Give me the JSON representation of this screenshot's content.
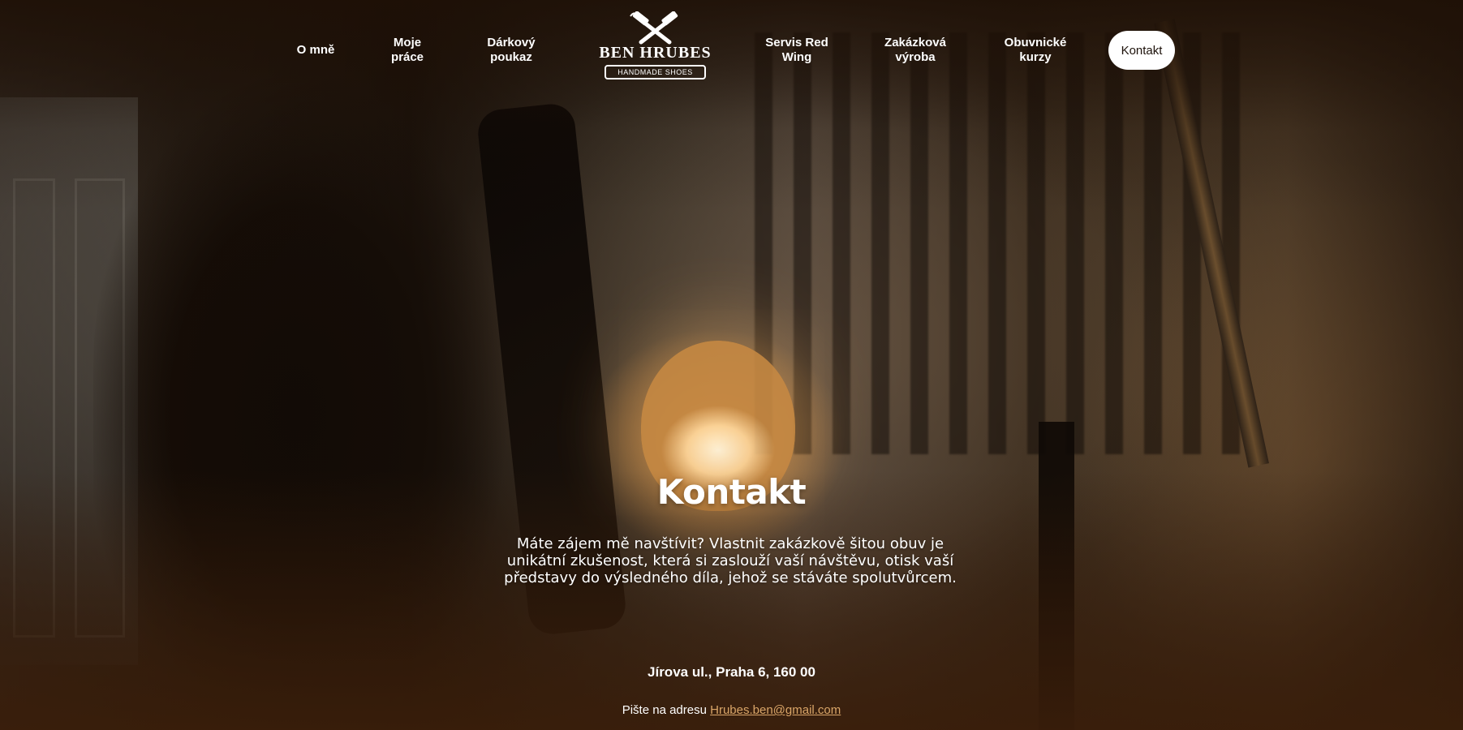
{
  "nav": {
    "items": [
      {
        "line1": "O mně",
        "line2": ""
      },
      {
        "line1": "Moje",
        "line2": "práce"
      },
      {
        "line1": "Dárkový",
        "line2": "poukaz"
      },
      {
        "line1": "Servis Red",
        "line2": "Wing"
      },
      {
        "line1": "Zakázková",
        "line2": "výroba"
      },
      {
        "line1": "Obuvnické",
        "line2": "kurzy"
      }
    ],
    "contact_label": "Kontakt"
  },
  "logo": {
    "name": "BEN HRUBES",
    "tagline": "HANDMADE SHOES",
    "icon": "crossed-hammers-icon"
  },
  "hero": {
    "title": "Kontakt",
    "intro_line1": "Máte zájem mě navštívit? Vlastnit zakázkově šitou obuv je",
    "intro_line2": "unikátní  zkušenost, která si zaslouží vaší návštěvu, otisk vaší",
    "intro_line3": "představy do výsledného díla, jehož se stáváte spolutvůrcem.",
    "address": "Jírova ul., Praha 6, 160 00",
    "email_prefix": "Pište na adresu",
    "email": "Hrubes.ben@gmail.com"
  },
  "colors": {
    "link": "#d9a568",
    "contact_bg": "#ffffff",
    "footer_tint": "#3a1e0a"
  }
}
